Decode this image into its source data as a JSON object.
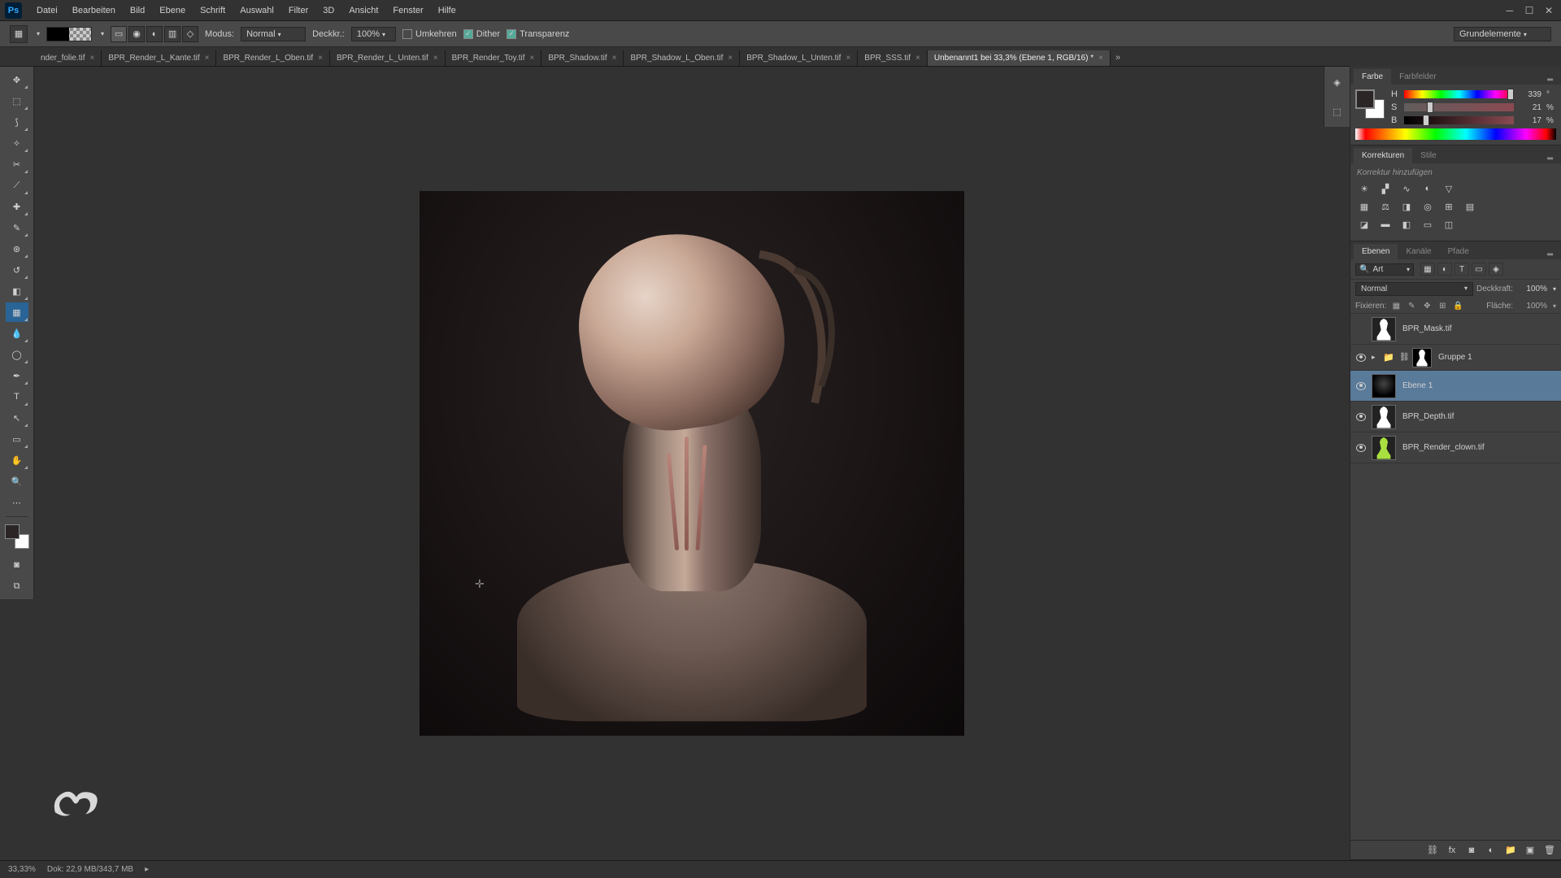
{
  "app": {
    "logo": "Ps"
  },
  "menu": [
    "Datei",
    "Bearbeiten",
    "Bild",
    "Ebene",
    "Schrift",
    "Auswahl",
    "Filter",
    "3D",
    "Ansicht",
    "Fenster",
    "Hilfe"
  ],
  "options": {
    "modus_label": "Modus:",
    "modus_value": "Normal",
    "deck_label": "Deckkr.:",
    "deck_value": "100%",
    "umkehren": "Umkehren",
    "dither": "Dither",
    "transparenz": "Transparenz",
    "right_label": "Grundelemente"
  },
  "tabs": [
    {
      "label": "nder_folie.tif",
      "active": false
    },
    {
      "label": "BPR_Render_L_Kante.tif",
      "active": false
    },
    {
      "label": "BPR_Render_L_Oben.tif",
      "active": false
    },
    {
      "label": "BPR_Render_L_Unten.tif",
      "active": false
    },
    {
      "label": "BPR_Render_Toy.tif",
      "active": false
    },
    {
      "label": "BPR_Shadow.tif",
      "active": false
    },
    {
      "label": "BPR_Shadow_L_Oben.tif",
      "active": false
    },
    {
      "label": "BPR_Shadow_L_Unten.tif",
      "active": false
    },
    {
      "label": "BPR_SSS.tif",
      "active": false
    },
    {
      "label": "Unbenannt1 bei 33,3% (Ebene 1, RGB/16) *",
      "active": true
    }
  ],
  "color_panel": {
    "tab1": "Farbe",
    "tab2": "Farbfelder",
    "h": {
      "label": "H",
      "value": "339",
      "unit": "°",
      "pos": 94
    },
    "s": {
      "label": "S",
      "value": "21",
      "unit": "%",
      "pos": 21
    },
    "b": {
      "label": "B",
      "value": "17",
      "unit": "%",
      "pos": 17
    }
  },
  "adjustments": {
    "tab1": "Korrekturen",
    "tab2": "Stile",
    "hint": "Korrektur hinzufügen"
  },
  "layers_panel": {
    "tab1": "Ebenen",
    "tab2": "Kanäle",
    "tab3": "Pfade",
    "search_kind": "Art",
    "blend": "Normal",
    "opacity_label": "Deckkraft:",
    "opacity_value": "100%",
    "lock_label": "Fixieren:",
    "fill_label": "Fläche:",
    "fill_value": "100%",
    "layers": [
      {
        "name": "BPR_Mask.tif",
        "visible": false,
        "type": "sil",
        "selected": false
      },
      {
        "name": "Gruppe 1",
        "visible": true,
        "type": "group",
        "selected": false
      },
      {
        "name": "Ebene 1",
        "visible": true,
        "type": "dark",
        "selected": true
      },
      {
        "name": "BPR_Depth.tif",
        "visible": true,
        "type": "sil",
        "selected": false
      },
      {
        "name": "BPR_Render_clown.tif",
        "visible": true,
        "type": "clown",
        "selected": false
      }
    ]
  },
  "status": {
    "zoom": "33,33%",
    "doc": "Dok: 22,9 MB/343,7 MB"
  }
}
